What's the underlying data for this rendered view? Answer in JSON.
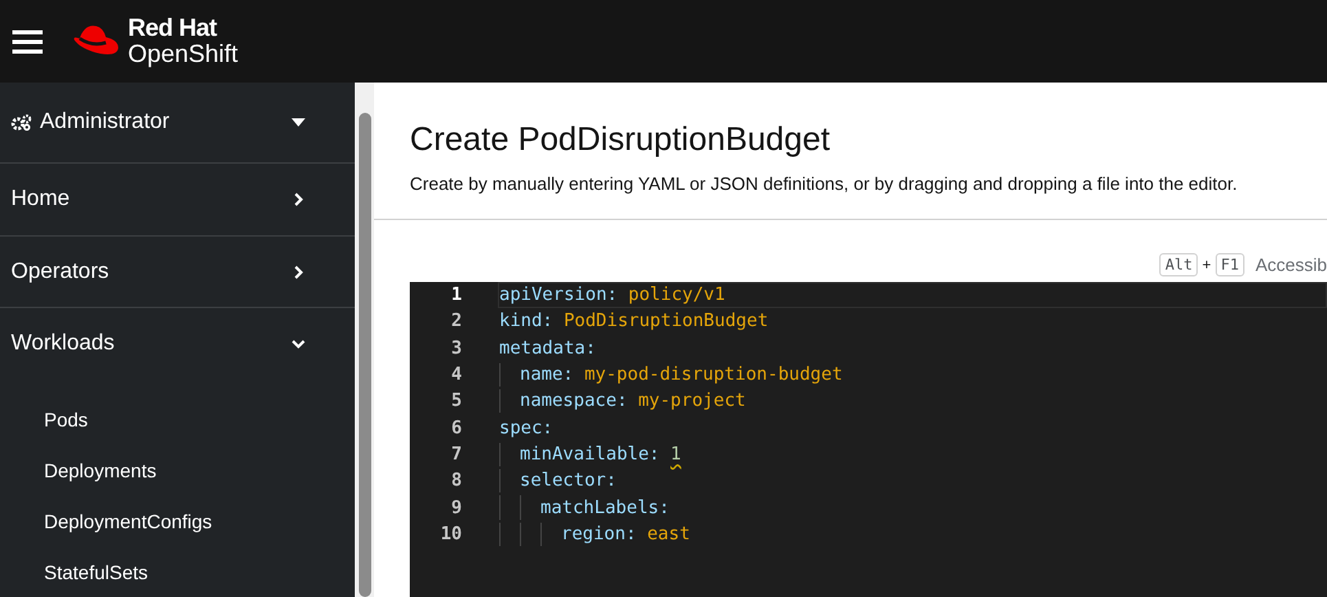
{
  "masthead": {
    "brand_line_1": "Red Hat",
    "brand_line_2": "OpenShift"
  },
  "sidebar": {
    "perspective": "Administrator",
    "items": [
      {
        "label": "Home",
        "expanded": false
      },
      {
        "label": "Operators",
        "expanded": false
      },
      {
        "label": "Workloads",
        "expanded": true,
        "children": [
          {
            "label": "Pods"
          },
          {
            "label": "Deployments"
          },
          {
            "label": "DeploymentConfigs"
          },
          {
            "label": "StatefulSets"
          }
        ]
      }
    ]
  },
  "page": {
    "title": "Create PodDisruptionBudget",
    "description": "Create by manually entering YAML or JSON definitions, or by dragging and dropping a file into the editor.",
    "shortcut": {
      "keys": [
        "Alt",
        "F1"
      ],
      "joiner": "+",
      "label": "Accessib"
    }
  },
  "editor": {
    "lines": [
      {
        "number": "1",
        "key": "apiVersion:",
        "value": "policy/v1",
        "kind": "string",
        "selected": true
      },
      {
        "number": "2",
        "key": "kind:",
        "value": "PodDisruptionBudget",
        "kind": "string",
        "selected": false
      },
      {
        "number": "3",
        "key": "metadata:",
        "selected": false,
        "children": [
          {
            "number": "4",
            "key": "name:",
            "value": "my-pod-disruption-budget",
            "kind": "string",
            "selected": false
          },
          {
            "number": "5",
            "key": "namespace:",
            "value": "my-project",
            "kind": "string",
            "selected": false
          }
        ]
      },
      {
        "number": "6",
        "key": "spec:",
        "selected": false,
        "children": [
          {
            "number": "7",
            "key": "minAvailable:",
            "value": "1",
            "kind": "number",
            "selected": false,
            "warning": true
          },
          {
            "number": "8",
            "key": "selector:",
            "selected": false,
            "children": [
              {
                "number": "9",
                "key": "matchLabels:",
                "selected": false,
                "children": [
                  {
                    "number": "10",
                    "key": "region:",
                    "value": "east",
                    "kind": "string",
                    "selected": false
                  }
                ]
              }
            ]
          }
        ]
      }
    ]
  }
}
